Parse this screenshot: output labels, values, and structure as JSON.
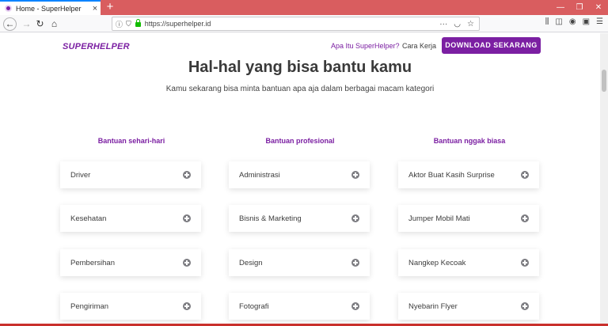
{
  "browser": {
    "tab_title": "Home - SuperHelper",
    "tab_close": "×",
    "new_tab": "+",
    "url": "https://superhelper.id",
    "window_controls": [
      "—",
      "❐",
      "✕"
    ]
  },
  "header": {
    "logo": "SUPERHELPER",
    "links": [
      "Apa Itu SuperHelper?",
      "Cara Kerja"
    ],
    "download_label": "DOWNLOAD SEKARANG"
  },
  "hero": {
    "title": "Hal-hal yang bisa bantu kamu",
    "subtitle": "Kamu sekarang bisa minta bantuan apa aja dalam berbagai macam kategori"
  },
  "columns": [
    {
      "title": "Bantuan sehari-hari",
      "items": [
        "Driver",
        "Kesehatan",
        "Pembersihan",
        "Pengiriman"
      ]
    },
    {
      "title": "Bantuan profesional",
      "items": [
        "Administrasi",
        "Bisnis & Marketing",
        "Design",
        "Fotografi"
      ]
    },
    {
      "title": "Bantuan nggak biasa",
      "items": [
        "Aktor Buat Kasih Surprise",
        "Jumper Mobil Mati",
        "Nangkep Kecoak",
        "Nyebarin Flyer"
      ]
    }
  ],
  "colors": {
    "brand": "#7b1fa2",
    "tabbar": "#d95d5f"
  }
}
